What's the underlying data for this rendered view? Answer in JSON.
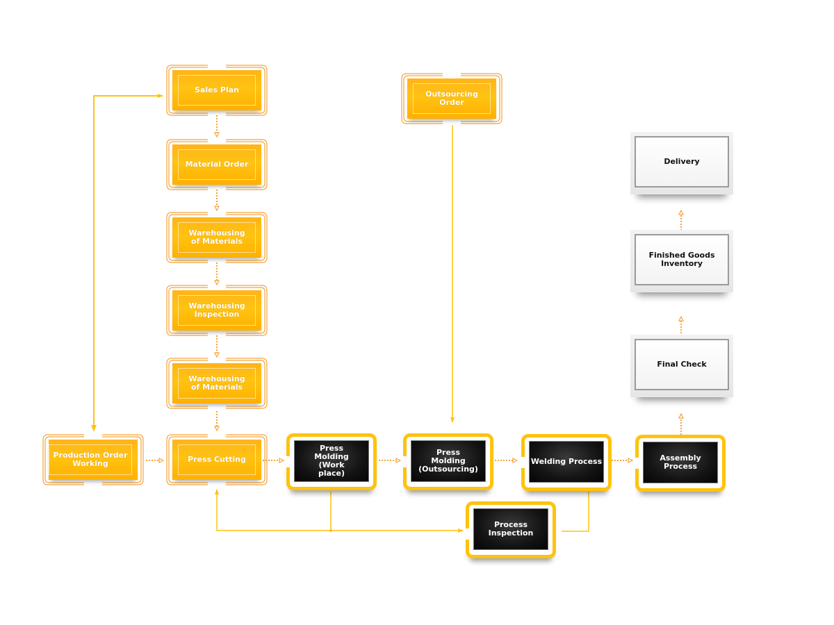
{
  "diagram": {
    "type": "process-flowchart",
    "colors": {
      "orange_node": "#ffbb14",
      "black_node": "#111111",
      "frame_yellow": "#ffc20e",
      "connector_solid": "#ffc20e",
      "connector_dotted": "#f5a33a",
      "white_node_border": "#9a9a9a"
    },
    "nodes": {
      "sales_plan": "Sales Plan",
      "material_order": "Material Order",
      "warehousing_materials_1": "Warehousing of Materials",
      "warehousing_inspection": "Warehousing Inspection",
      "warehousing_materials_2": "Warehousing of Materials",
      "production_order": "Production Order Working",
      "press_cutting": "Press Cutting",
      "outsourcing_order": "Outsourcing Order",
      "press_molding_work": "Press Molding (Work place)",
      "press_molding_out": "Press Molding (Outsourcing)",
      "welding": "Welding Process",
      "assembly": "Assembly Process",
      "process_inspection": "Process Inspection",
      "final_check": "Final Check",
      "finished_goods": "Finished Goods Inventory",
      "delivery": "Delivery"
    },
    "edges": [
      {
        "from": "production_order",
        "to": "sales_plan",
        "style": "solid"
      },
      {
        "from": "sales_plan",
        "to": "material_order",
        "style": "dotted"
      },
      {
        "from": "material_order",
        "to": "warehousing_materials_1",
        "style": "dotted"
      },
      {
        "from": "warehousing_materials_1",
        "to": "warehousing_inspection",
        "style": "dotted"
      },
      {
        "from": "warehousing_inspection",
        "to": "warehousing_materials_2",
        "style": "dotted"
      },
      {
        "from": "warehousing_materials_2",
        "to": "press_cutting",
        "style": "dotted"
      },
      {
        "from": "production_order",
        "to": "press_cutting",
        "style": "dotted"
      },
      {
        "from": "press_cutting",
        "to": "press_molding_work",
        "style": "dotted"
      },
      {
        "from": "press_molding_work",
        "to": "press_molding_out",
        "style": "dotted"
      },
      {
        "from": "outsourcing_order",
        "to": "press_molding_out",
        "style": "solid"
      },
      {
        "from": "press_molding_out",
        "to": "welding",
        "style": "dotted"
      },
      {
        "from": "welding",
        "to": "assembly",
        "style": "dotted"
      },
      {
        "from": "press_molding_work",
        "to": "process_inspection",
        "style": "solid"
      },
      {
        "from": "welding",
        "to": "process_inspection",
        "style": "solid"
      },
      {
        "from": "process_inspection",
        "to": "press_cutting",
        "style": "solid"
      },
      {
        "from": "assembly",
        "to": "final_check",
        "style": "dotted"
      },
      {
        "from": "final_check",
        "to": "finished_goods",
        "style": "dotted"
      },
      {
        "from": "finished_goods",
        "to": "delivery",
        "style": "dotted"
      }
    ]
  }
}
